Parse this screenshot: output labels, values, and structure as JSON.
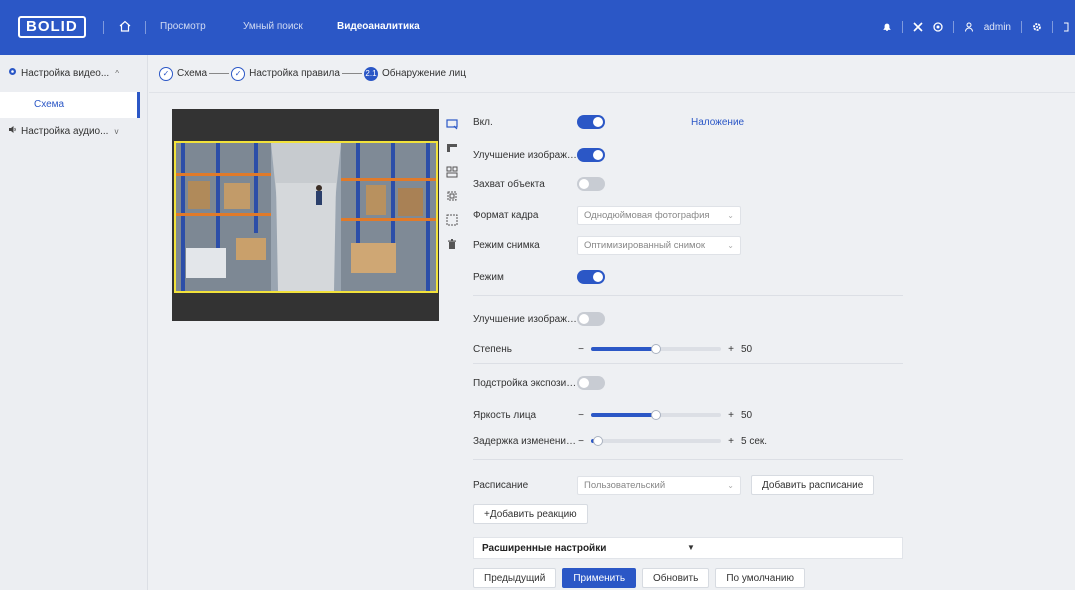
{
  "header": {
    "logo": "BOLID",
    "nav": [
      "Просмотр",
      "Умный поиск",
      "Видеоаналитика"
    ],
    "active_nav": "Видеоаналитика",
    "user": "admin"
  },
  "sidebar": {
    "groups": [
      {
        "label": "Настройка видео...",
        "chevron": "^",
        "icon": "video-settings-icon"
      },
      {
        "label": "Настройка аудио...",
        "chevron": "v",
        "icon": "speaker-icon"
      }
    ],
    "active_item": "Схема"
  },
  "steps": [
    {
      "label": "Схема",
      "state": "done",
      "mark": "✓"
    },
    {
      "label": "Настройка правила",
      "state": "done",
      "mark": "✓"
    },
    {
      "label": "Обнаружение лиц",
      "state": "current",
      "mark": "2.1"
    }
  ],
  "form": {
    "enable": {
      "label": "Вкл.",
      "value": true
    },
    "overlay_link": "Наложение",
    "enhance1": {
      "label": "Улучшение изображе...",
      "value": true
    },
    "capture": {
      "label": "Захват объекта",
      "value": false
    },
    "frame_format": {
      "label": "Формат кадра",
      "value": "Однодюймовая фотография"
    },
    "snapshot_mode": {
      "label": "Режим снимка",
      "value": "Оптимизированный снимок"
    },
    "mode": {
      "label": "Режим",
      "value": true
    },
    "enhance2": {
      "label": "Улучшение изображе...",
      "value": false
    },
    "degree": {
      "label": "Степень",
      "value": 50,
      "display": "50",
      "max": 100
    },
    "exposure": {
      "label": "Подстройка экспозици...",
      "value": false
    },
    "face_brightness": {
      "label": "Яркость лица",
      "value": 50,
      "display": "50",
      "max": 100
    },
    "delay": {
      "label": "Задержка изменения э...",
      "value": 5,
      "display": "5 сек.",
      "max": 100
    },
    "minus": "−",
    "plus": "+",
    "schedule": {
      "label": "Расписание",
      "value": "Пользовательский"
    },
    "add_schedule": "Добавить расписание",
    "add_reaction": "+Добавить реакцию",
    "advanced": "Расширенные настройки"
  },
  "buttons": {
    "prev": "Предыдущий",
    "apply": "Применить",
    "refresh": "Обновить",
    "default": "По умолчанию"
  },
  "colors": {
    "accent": "#2b57c6",
    "roi_border": "#f2e23b",
    "background": "#eef0f3"
  }
}
